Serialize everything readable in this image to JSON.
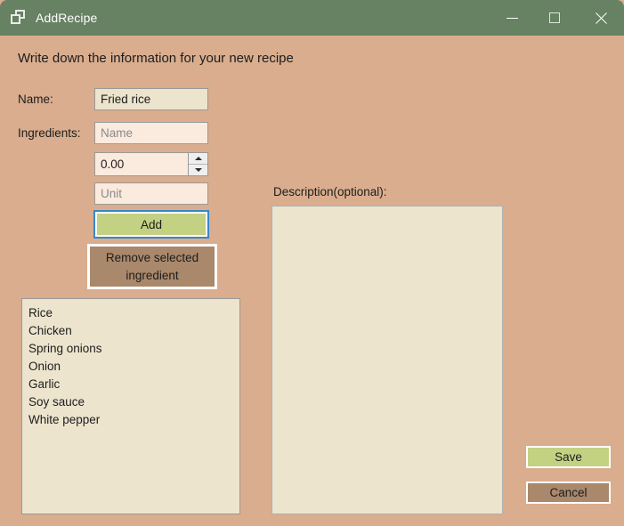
{
  "window": {
    "title": "AddRecipe",
    "icon": "window-stack-icon",
    "controls": {
      "minimize": "minimize-icon",
      "maximize": "maximize-icon",
      "close": "close-icon"
    },
    "titlebar_color": "#678163",
    "background_color": "#d9ad8e"
  },
  "form": {
    "heading": "Write down the information for your new recipe",
    "name_label": "Name:",
    "name_value": "Fried rice",
    "ingredients_label": "Ingredients:",
    "ingredient_name_placeholder": "Name",
    "quantity_value": "0.00",
    "unit_placeholder": "Unit",
    "description_label": "Description(optional):",
    "description_value": ""
  },
  "buttons": {
    "add": "Add",
    "remove": "Remove selected ingredient",
    "save": "Save",
    "cancel": "Cancel",
    "add_color": "#c3d183",
    "remove_color": "#a9886b",
    "save_color": "#c3d183",
    "cancel_color": "#a9886b",
    "focus_ring_color": "#3a86c8"
  },
  "ingredients": [
    "Rice",
    "Chicken",
    "Spring onions",
    "Onion",
    "Garlic",
    "Soy sauce",
    "White pepper"
  ]
}
